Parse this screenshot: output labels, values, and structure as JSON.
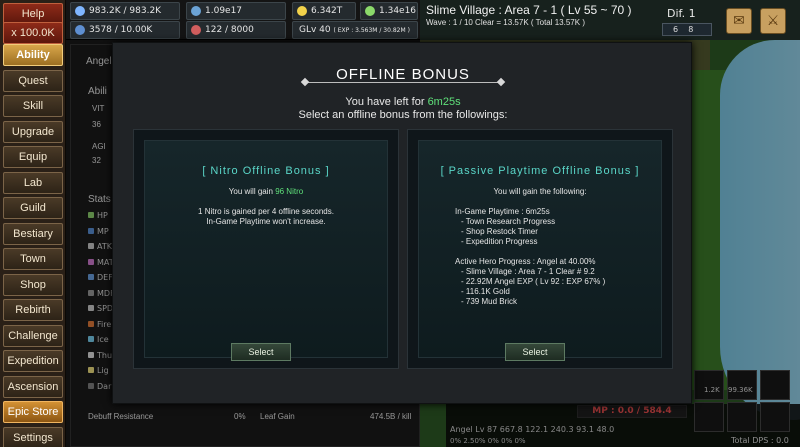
{
  "menu": {
    "help": "Help",
    "speed": "x 100.0K",
    "items": [
      "Ability",
      "Quest",
      "Skill",
      "Upgrade",
      "Equip",
      "Lab",
      "Guild",
      "Bestiary",
      "Town",
      "Shop",
      "Rebirth",
      "Challenge",
      "Expedition",
      "Ascension",
      "Epic Store",
      "Settings"
    ]
  },
  "resources": {
    "r1": "983.2K / 983.2K",
    "r2": "1.09e17",
    "r3": "6.342T",
    "r4": "1.34e16",
    "r5": "3578 / 10.00K",
    "r6": "122 / 8000",
    "glv": "GLv 40",
    "exp": "( EXP : 3.563M / 30.82M )"
  },
  "hud": {
    "zone": "Slime Village : Area 7 - 1 ( Lv 55 ~ 70 )",
    "wave": "Wave : 1 / 10   Clear = 13.57K ( Total 13.57K )",
    "dif": "Dif. 1",
    "dif_a": "6",
    "dif_b": "8",
    "mp": "MP : 0.0 / 584.4",
    "char": "Angel Lv 87   667.8   122.1   240.3   93.1   48.0",
    "pcts": "0%  2.50%  0%  0%  0%",
    "total_dps": "Total DPS : 0.0",
    "slot_a": "1.2K",
    "slot_b": "99.36K"
  },
  "panel": {
    "title": "Angel",
    "ability": "Abili",
    "vit_label": "VIT",
    "vit_val": "36",
    "agi_label": "AGI",
    "agi_val": "32",
    "stats_title": "Stats",
    "stats": [
      "HP",
      "MP",
      "ATK",
      "MAT",
      "DEF",
      "MDF",
      "SPD",
      "Fire",
      "Ice",
      "Thu",
      "Lig",
      "Dar"
    ],
    "debuff": "Debuff Resistance",
    "debuff_val": "0%",
    "leaf": "Leaf Gain",
    "leaf_val": "474.5B / kill"
  },
  "modal": {
    "title": "OFFLINE BONUS",
    "left_prefix": "You have left for ",
    "left_time": "6m25s",
    "instruction": "Select an offline bonus from the followings:",
    "nitro": {
      "title": "[ Nitro Offline Bonus ]",
      "gain_prefix": "You will gain ",
      "gain_value": "96 Nitro",
      "desc1": "1 Nitro is gained per 4 offline seconds.",
      "desc2": "In-Game Playtime won't increase.",
      "button": "Select"
    },
    "passive": {
      "title": "[ Passive Playtime Offline Bonus ]",
      "gain": "You will gain the following:",
      "playtime": "In-Game Playtime : 6m25s",
      "l1": "- Town Research Progress",
      "l2": "- Shop Restock Timer",
      "l3": "- Expedition Progress",
      "hero": "Active Hero Progress : Angel at 40.00%",
      "h1": "- Slime Village : Area 7 - 1 Clear # 9.2",
      "h2": "- 22.92M Angel EXP ( Lv 92 : EXP 67% )",
      "h3": "- 116.1K Gold",
      "h4": "- 739 Mud Brick",
      "button": "Select"
    }
  },
  "colors": {
    "accent_green": "#5fe07a",
    "card_title": "#5ad6c8",
    "mp_red": "#f05050"
  }
}
